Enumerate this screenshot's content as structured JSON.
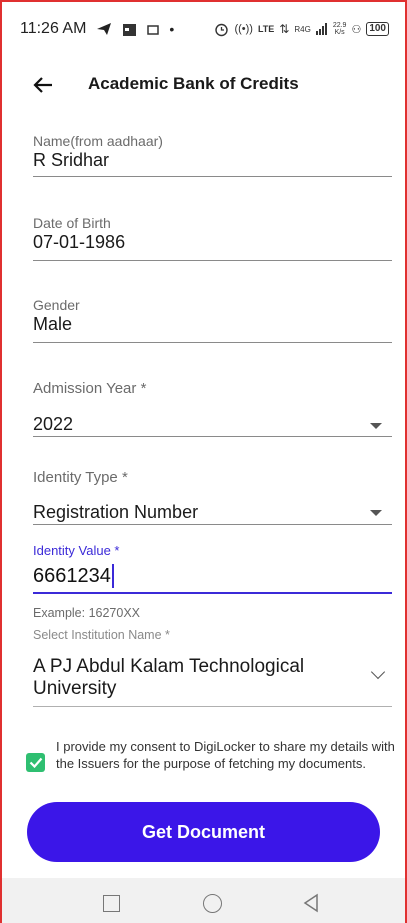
{
  "status_bar": {
    "time": "11:26 AM",
    "network_label": "LTE",
    "signal_label": "R4G",
    "speed_value": "22.9",
    "speed_unit": "K/s",
    "battery": "100"
  },
  "app_bar": {
    "title": "Academic Bank of Credits",
    "back_icon": "arrow-left-icon"
  },
  "fields": {
    "name": {
      "label": "Name(from aadhaar)",
      "value": "R Sridhar"
    },
    "dob": {
      "label": "Date of Birth",
      "value": "07-01-1986"
    },
    "gender": {
      "label": "Gender",
      "value": "Male"
    }
  },
  "selects": {
    "admission_year": {
      "label": "Admission Year *",
      "value": "2022"
    },
    "identity_type": {
      "label": "Identity Type *",
      "value": "Registration Number"
    }
  },
  "identity_value": {
    "label": "Identity Value *",
    "value": "6661234",
    "hint": "Example: 16270XX"
  },
  "institution": {
    "label": "Select Institution Name *",
    "value": "A PJ Abdul Kalam Technological University"
  },
  "consent": {
    "checked": true,
    "text": "I provide my consent to DigiLocker to share my details with the Issuers for the purpose of fetching my documents."
  },
  "primary_button": {
    "label": "Get Document"
  },
  "colors": {
    "accent": "#3b16e8",
    "focus": "#3b2ad8",
    "checkbox": "#2fbf71"
  }
}
